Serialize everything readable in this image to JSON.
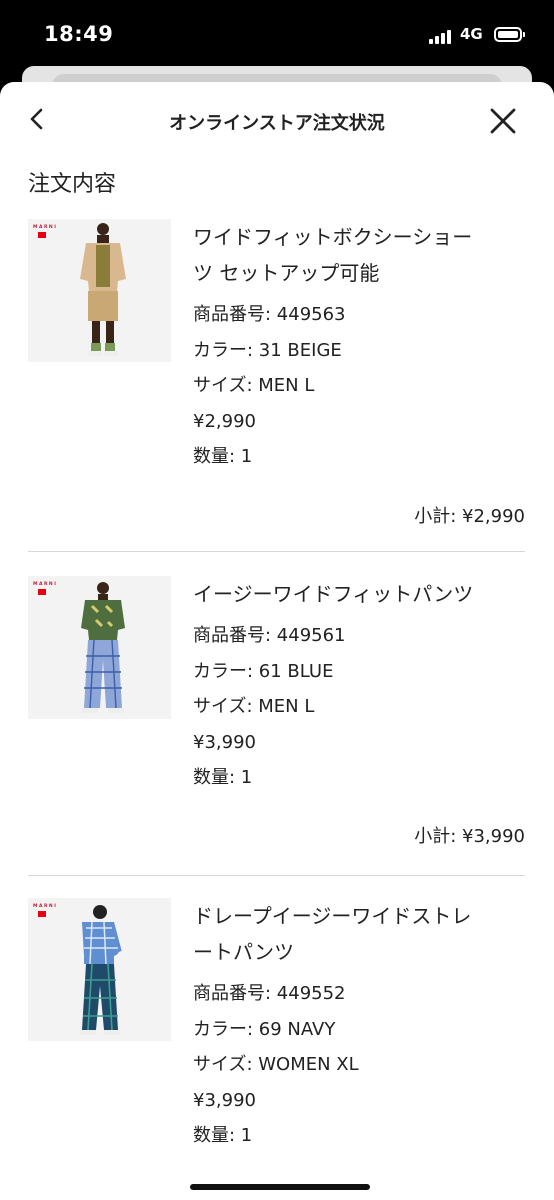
{
  "status": {
    "time": "18:49",
    "network": "4G"
  },
  "header": {
    "title": "オンラインストア注文状況"
  },
  "section_title": "注文内容",
  "items": [
    {
      "name_line1": "ワイドフィットボクシーショー",
      "name_line2": "ツ セットアップ可能",
      "product_no": "商品番号: 449563",
      "color": "カラー: 31 BEIGE",
      "size": "サイズ: MEN L",
      "price": "¥2,990",
      "qty": "数量: 1",
      "subtotal": "小計: ¥2,990",
      "logo_text": "MARNI"
    },
    {
      "name_line1": "イージーワイドフィットパンツ",
      "name_line2": "",
      "product_no": "商品番号: 449561",
      "color": "カラー: 61 BLUE",
      "size": "サイズ: MEN L",
      "price": "¥3,990",
      "qty": "数量: 1",
      "subtotal": "小計: ¥3,990",
      "logo_text": "MARNI"
    },
    {
      "name_line1": "ドレープイージーワイドストレ",
      "name_line2": "ートパンツ",
      "product_no": "商品番号: 449552",
      "color": "カラー: 69 NAVY",
      "size": "サイズ: WOMEN XL",
      "price": "¥3,990",
      "qty": "数量: 1",
      "subtotal": "",
      "logo_text": "MARNI"
    }
  ],
  "icons": {
    "back": "chevron-left-icon",
    "close": "close-icon"
  },
  "colors": {
    "text": "#222222",
    "divider": "#d7d7d7",
    "brand_red": "#e60012"
  }
}
